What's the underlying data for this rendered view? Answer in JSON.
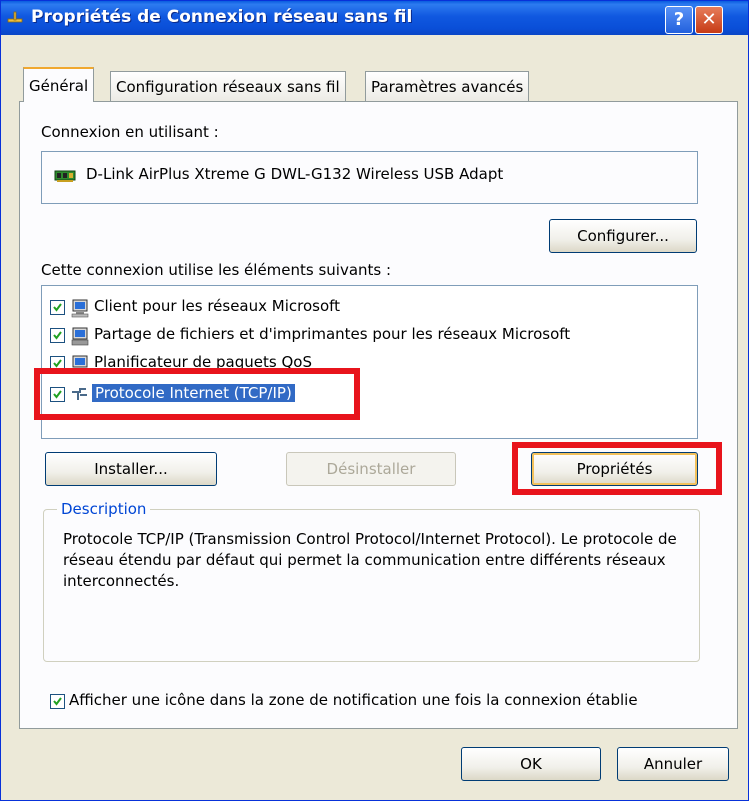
{
  "window": {
    "title": "Propriétés de Connexion réseau sans fil",
    "help": "?",
    "close": "✕"
  },
  "tabs": [
    {
      "label": "Général",
      "active": true
    },
    {
      "label": "Configuration réseaux sans fil",
      "active": false
    },
    {
      "label": "Paramètres avancés",
      "active": false
    }
  ],
  "general": {
    "connect_using_label": "Connexion en utilisant :",
    "adapter_name": "D-Link AirPlus Xtreme G DWL-G132 Wireless USB Adapt",
    "configure_button": "Configurer...",
    "components_label": "Cette connexion utilise les éléments suivants :",
    "components": [
      {
        "label": "Client pour les réseaux Microsoft",
        "checked": true,
        "icon": "network-client-icon"
      },
      {
        "label": "Partage de fichiers et d'imprimantes pour les réseaux Microsoft",
        "checked": true,
        "icon": "file-sharing-icon"
      },
      {
        "label": "Planificateur de paquets QoS",
        "checked": true,
        "icon": "qos-scheduler-icon"
      },
      {
        "label": "Protocole Internet (TCP/IP)",
        "checked": true,
        "selected": true,
        "icon": "protocol-icon"
      }
    ],
    "install_button": "Installer...",
    "uninstall_button": "Désinstaller",
    "properties_button": "Propriétés",
    "description_title": "Description",
    "description_text": "Protocole TCP/IP (Transmission Control Protocol/Internet Protocol). Le protocole de réseau étendu par défaut qui permet la communication entre différents réseaux interconnectés.",
    "notify_checkbox_label": "Afficher une icône dans la zone de notification une fois la connexion établie",
    "notify_checked": true
  },
  "footer": {
    "ok_button": "OK",
    "cancel_button": "Annuler"
  },
  "colors": {
    "titlebar": "#0a4fd8",
    "highlight": "#e8141c",
    "selection": "#316ac5",
    "dialog_bg": "#ece9d8"
  }
}
